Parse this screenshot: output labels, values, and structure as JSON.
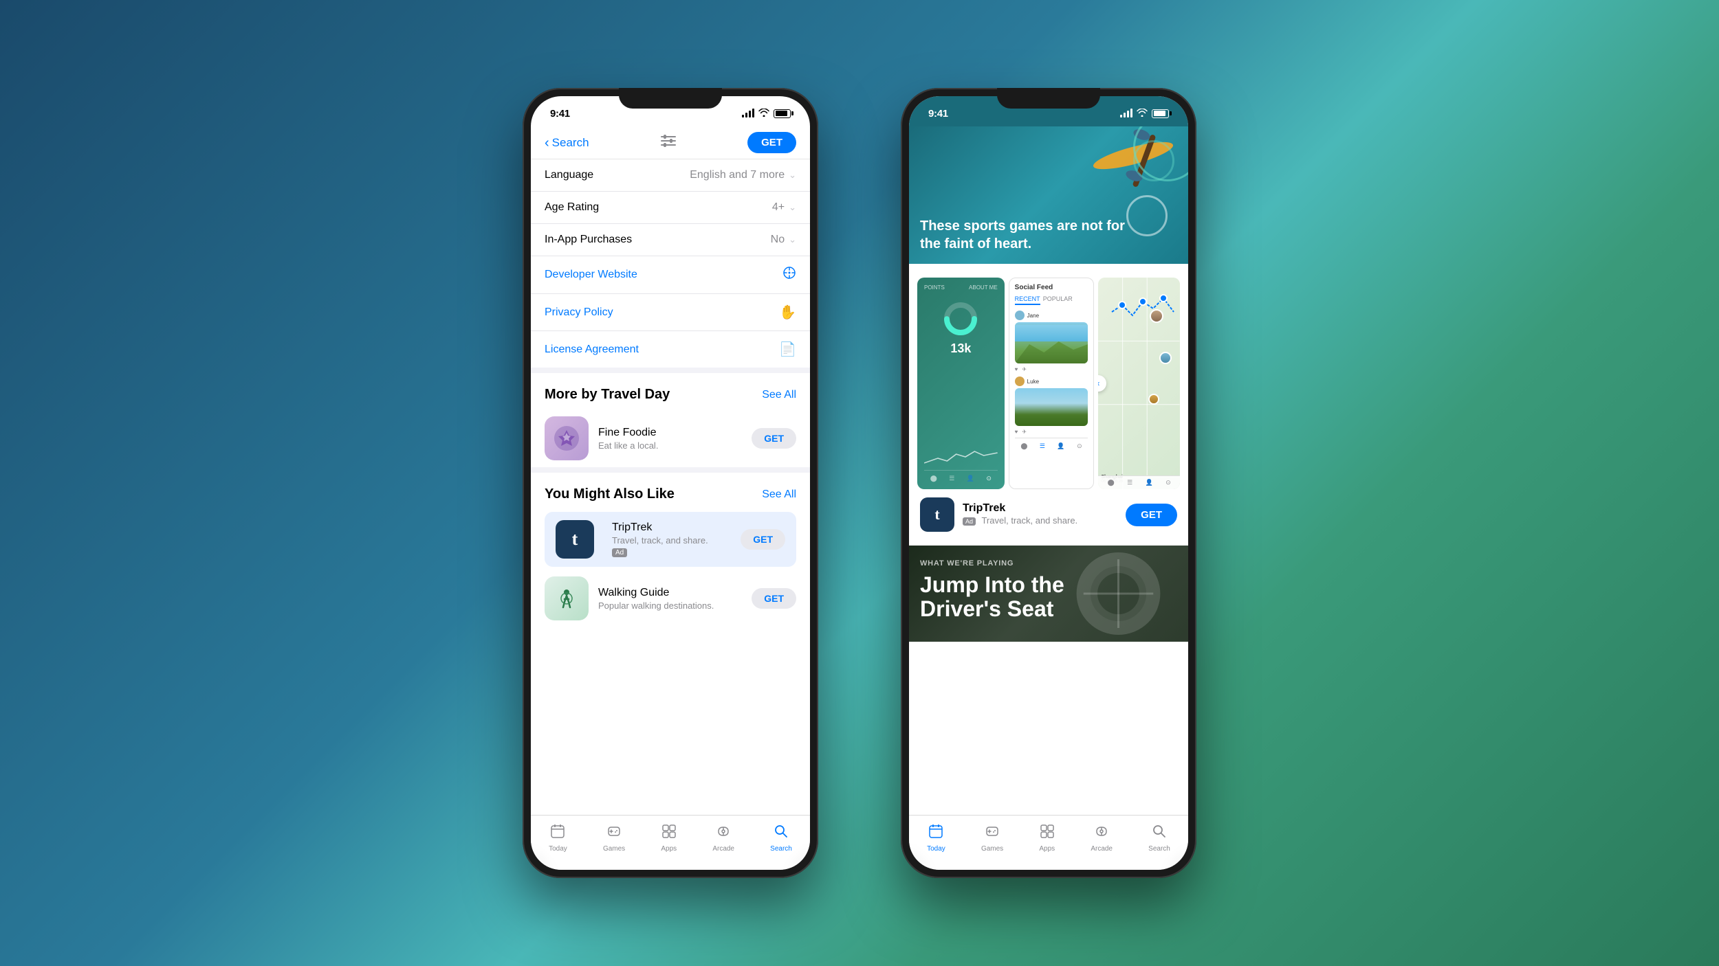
{
  "background": {
    "gradient": "linear-gradient(135deg, #1a4a6b 0%, #2a7a9a 40%, #4ab8b8 55%, #3a9a7a 70%, #2a7a5a 100%)"
  },
  "phone1": {
    "status_bar": {
      "time": "9:41",
      "signal": "signal",
      "wifi": "wifi",
      "battery": "battery"
    },
    "nav": {
      "back_label": "Search",
      "filter_icon": "filter",
      "get_button": "GET"
    },
    "info_rows": [
      {
        "label": "Language",
        "value": "English and 7 more",
        "type": "dropdown"
      },
      {
        "label": "Age Rating",
        "value": "4+",
        "type": "dropdown"
      },
      {
        "label": "In-App Purchases",
        "value": "No",
        "type": "dropdown"
      }
    ],
    "info_links": [
      {
        "label": "Developer Website",
        "icon": "compass"
      },
      {
        "label": "Privacy Policy",
        "icon": "hand"
      },
      {
        "label": "License Agreement",
        "icon": "document"
      }
    ],
    "more_section": {
      "title": "More by Travel Day",
      "see_all": "See All",
      "apps": [
        {
          "name": "Fine Foodie",
          "subtitle": "Eat like a local.",
          "icon_type": "foodie",
          "button": "GET"
        }
      ]
    },
    "also_like_section": {
      "title": "You Might Also Like",
      "see_all": "See All",
      "apps": [
        {
          "name": "TripTrek",
          "subtitle": "Travel, track, and share.",
          "ad": true,
          "icon_type": "triptrek",
          "button": "GET",
          "highlighted": true
        },
        {
          "name": "Walking Guide",
          "subtitle": "Popular walking destinations.",
          "icon_type": "walking",
          "button": "GET"
        }
      ]
    },
    "tab_bar": {
      "tabs": [
        {
          "icon": "📱",
          "label": "Today"
        },
        {
          "icon": "🎮",
          "label": "Games"
        },
        {
          "icon": "🎓",
          "label": "Apps"
        },
        {
          "icon": "👤",
          "label": "Arcade"
        },
        {
          "icon": "🔍",
          "label": "Search",
          "active": true
        }
      ]
    }
  },
  "phone2": {
    "status_bar": {
      "time": "9:41"
    },
    "sports_card": {
      "headline": "These sports games are not for\nthe faint of heart."
    },
    "ad_card": {
      "screenshots": [
        {
          "type": "stats",
          "number": "13k"
        },
        {
          "type": "social_feed",
          "title": "Social Feed"
        },
        {
          "type": "map",
          "city": "Shanghai"
        }
      ],
      "app": {
        "name": "TripTrek",
        "ad_label": "Ad",
        "subtitle": "Travel, track, and share.",
        "button": "GET"
      }
    },
    "playing_card": {
      "label": "WHAT WE'RE PLAYING",
      "title": "Jump Into the\nDriver's Seat"
    },
    "tab_bar": {
      "tabs": [
        {
          "icon": "📱",
          "label": "Today",
          "active": true
        },
        {
          "icon": "🎮",
          "label": "Games"
        },
        {
          "icon": "🎓",
          "label": "Apps"
        },
        {
          "icon": "👤",
          "label": "Arcade"
        },
        {
          "icon": "🔍",
          "label": "Search"
        }
      ]
    }
  }
}
